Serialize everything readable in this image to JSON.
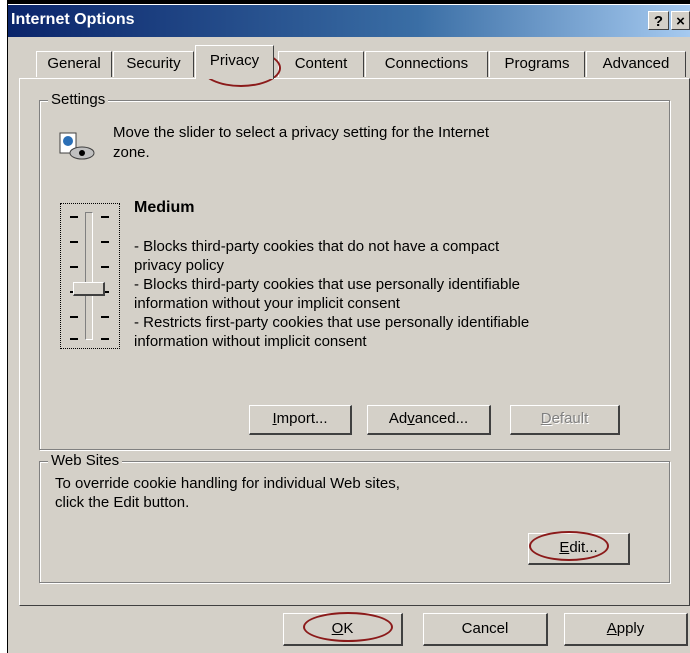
{
  "window": {
    "title": "Internet Options",
    "help_glyph": "?",
    "close_glyph": "×"
  },
  "tabs": [
    {
      "label": "General"
    },
    {
      "label": "Security"
    },
    {
      "label": "Privacy"
    },
    {
      "label": "Content"
    },
    {
      "label": "Connections"
    },
    {
      "label": "Programs"
    },
    {
      "label": "Advanced"
    }
  ],
  "active_tab": "Privacy",
  "settings": {
    "group_label": "Settings",
    "instruction_line1": "Move the slider to select a privacy setting for the Internet",
    "instruction_line2": "zone.",
    "level_title": "Medium",
    "desc": [
      "- Blocks third-party cookies that do not have a compact",
      "privacy policy",
      "- Blocks third-party cookies that use personally identifiable",
      "information without your implicit consent",
      "- Restricts first-party cookies that use personally identifiable",
      "information without implicit consent"
    ],
    "slider_level": "Medium",
    "buttons": {
      "import_pre": "",
      "import_key": "I",
      "import_post": "mport...",
      "advanced_pre": "Ad",
      "advanced_key": "v",
      "advanced_post": "anced...",
      "default_pre": "",
      "default_key": "D",
      "default_post": "efault"
    }
  },
  "web_sites": {
    "group_label": "Web Sites",
    "line1": "To override cookie handling for individual Web sites,",
    "line2": "click the Edit button.",
    "edit_key": "E",
    "edit_post": "dit..."
  },
  "footer": {
    "ok_key": "O",
    "ok_post": "K",
    "cancel": "Cancel",
    "apply_key": "A",
    "apply_post": "pply"
  },
  "colors": {
    "dialog_bg": "#d4d0c8",
    "title_gradient_start": "#0a246a",
    "annotation_circle": "#8b1a1a"
  }
}
